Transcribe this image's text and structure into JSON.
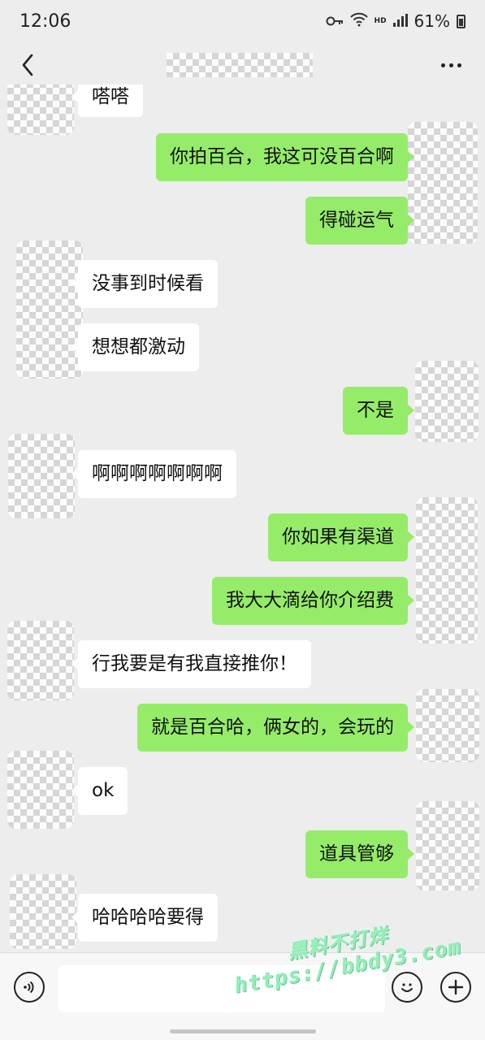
{
  "status_bar": {
    "time": "12:06",
    "hd_label": "HD",
    "battery": "61%"
  },
  "nav": {
    "back_icon": "chevron-left-icon",
    "more_icon": "more-horizontal-icon"
  },
  "messages": [
    {
      "side": "recv",
      "text": "嗒嗒"
    },
    {
      "side": "sent",
      "text": "你拍百合，我这可没百合啊"
    },
    {
      "side": "sent",
      "text": "得碰运气"
    },
    {
      "side": "recv",
      "text": "没事到时候看"
    },
    {
      "side": "recv",
      "text": "想想都激动"
    },
    {
      "side": "sent",
      "text": "不是"
    },
    {
      "side": "recv",
      "text": "啊啊啊啊啊啊啊"
    },
    {
      "side": "sent",
      "text": "你如果有渠道"
    },
    {
      "side": "sent",
      "text": "我大大滴给你介绍费"
    },
    {
      "side": "recv",
      "text": "行我要是有我直接推你！"
    },
    {
      "side": "sent",
      "text": "就是百合哈，俩女的，会玩的"
    },
    {
      "side": "recv",
      "text": "ok"
    },
    {
      "side": "sent",
      "text": "道具管够"
    },
    {
      "side": "recv",
      "text": "哈哈哈哈要得"
    }
  ],
  "input_bar": {
    "voice_icon": "voice-icon",
    "emoji_icon": "emoji-icon",
    "plus_icon": "plus-icon",
    "message_value": ""
  },
  "watermark": {
    "line1": "黑料不打烊",
    "line2": "https://bbdy3.com"
  },
  "colors": {
    "chat_background": "#ededed",
    "sent_bubble": "#95ec69",
    "received_bubble": "#ffffff",
    "watermark": "#8ff0b7"
  }
}
